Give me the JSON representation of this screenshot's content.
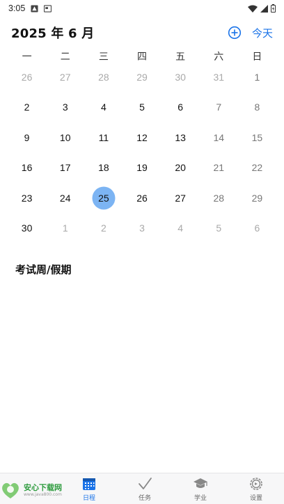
{
  "status_bar": {
    "time": "3:05"
  },
  "header": {
    "title": "2025 年 6 月",
    "today_label": "今天"
  },
  "weekdays": [
    "一",
    "二",
    "三",
    "四",
    "五",
    "六",
    "日"
  ],
  "calendar": {
    "weeks": [
      [
        {
          "d": "26",
          "m": true
        },
        {
          "d": "27",
          "m": true
        },
        {
          "d": "28",
          "m": true
        },
        {
          "d": "29",
          "m": true
        },
        {
          "d": "30",
          "m": true
        },
        {
          "d": "31",
          "m": true
        },
        {
          "d": "1",
          "m": false
        }
      ],
      [
        {
          "d": "2"
        },
        {
          "d": "3"
        },
        {
          "d": "4"
        },
        {
          "d": "5"
        },
        {
          "d": "6"
        },
        {
          "d": "7"
        },
        {
          "d": "8"
        }
      ],
      [
        {
          "d": "9"
        },
        {
          "d": "10"
        },
        {
          "d": "11"
        },
        {
          "d": "12"
        },
        {
          "d": "13"
        },
        {
          "d": "14"
        },
        {
          "d": "15"
        }
      ],
      [
        {
          "d": "16"
        },
        {
          "d": "17"
        },
        {
          "d": "18"
        },
        {
          "d": "19"
        },
        {
          "d": "20"
        },
        {
          "d": "21"
        },
        {
          "d": "22"
        }
      ],
      [
        {
          "d": "23"
        },
        {
          "d": "24"
        },
        {
          "d": "25",
          "selected": true
        },
        {
          "d": "26"
        },
        {
          "d": "27"
        },
        {
          "d": "28"
        },
        {
          "d": "29"
        }
      ],
      [
        {
          "d": "30"
        },
        {
          "d": "1",
          "m": true
        },
        {
          "d": "2",
          "m": true
        },
        {
          "d": "3",
          "m": true
        },
        {
          "d": "4",
          "m": true
        },
        {
          "d": "5",
          "m": true
        },
        {
          "d": "6",
          "m": true
        }
      ]
    ],
    "selected_color": "#7cb4f3"
  },
  "section": {
    "title": "考试周/假期"
  },
  "bottom_nav": {
    "items": [
      {
        "label": "日程",
        "icon": "calendar-icon",
        "active": true
      },
      {
        "label": "任务",
        "icon": "check-icon"
      },
      {
        "label": "学业",
        "icon": "graduation-cap-icon"
      },
      {
        "label": "设置",
        "icon": "gear-icon"
      }
    ],
    "accent_color": "#1a73e8"
  },
  "watermark": {
    "brand": "安心下载网",
    "url": "www.java800.com"
  }
}
